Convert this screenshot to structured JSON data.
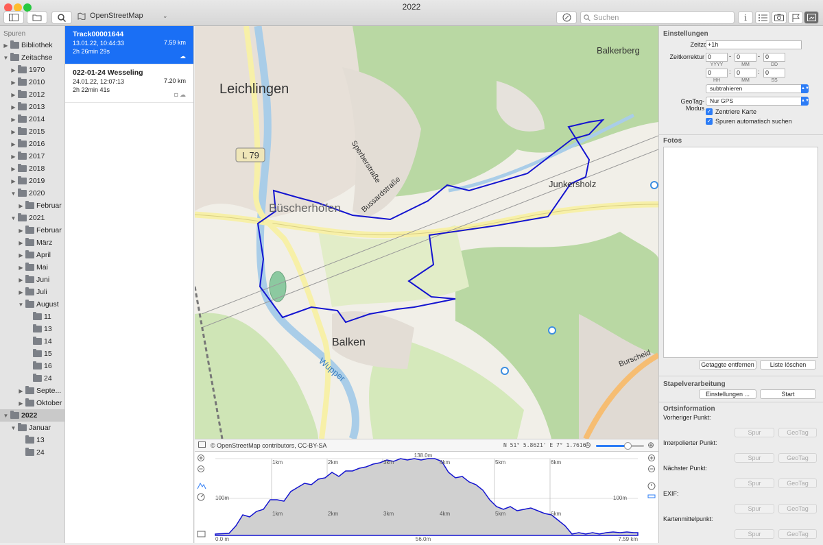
{
  "window": {
    "title": "2022"
  },
  "toolbar": {
    "map_source": "OpenStreetMap",
    "search_placeholder": "Suchen"
  },
  "sidebar": {
    "header": "Spuren",
    "items": [
      {
        "label": "Bibliothek",
        "level": 0,
        "expanded": false
      },
      {
        "label": "Zeitachse",
        "level": 0,
        "expanded": true
      },
      {
        "label": "1970",
        "level": 1,
        "expanded": false
      },
      {
        "label": "2010",
        "level": 1,
        "expanded": false
      },
      {
        "label": "2012",
        "level": 1,
        "expanded": false
      },
      {
        "label": "2013",
        "level": 1,
        "expanded": false
      },
      {
        "label": "2014",
        "level": 1,
        "expanded": false
      },
      {
        "label": "2015",
        "level": 1,
        "expanded": false
      },
      {
        "label": "2016",
        "level": 1,
        "expanded": false
      },
      {
        "label": "2017",
        "level": 1,
        "expanded": false
      },
      {
        "label": "2018",
        "level": 1,
        "expanded": false
      },
      {
        "label": "2019",
        "level": 1,
        "expanded": false
      },
      {
        "label": "2020",
        "level": 1,
        "expanded": true
      },
      {
        "label": "Februar",
        "level": 2,
        "expanded": false
      },
      {
        "label": "2021",
        "level": 1,
        "expanded": true
      },
      {
        "label": "Februar",
        "level": 2,
        "expanded": false
      },
      {
        "label": "März",
        "level": 2,
        "expanded": false
      },
      {
        "label": "April",
        "level": 2,
        "expanded": false
      },
      {
        "label": "Mai",
        "level": 2,
        "expanded": false
      },
      {
        "label": "Juni",
        "level": 2,
        "expanded": false
      },
      {
        "label": "Juli",
        "level": 2,
        "expanded": false
      },
      {
        "label": "August",
        "level": 2,
        "expanded": true
      },
      {
        "label": "11",
        "level": 3,
        "leaf": true
      },
      {
        "label": "13",
        "level": 3,
        "leaf": true
      },
      {
        "label": "14",
        "level": 3,
        "leaf": true
      },
      {
        "label": "15",
        "level": 3,
        "leaf": true
      },
      {
        "label": "16",
        "level": 3,
        "leaf": true
      },
      {
        "label": "24",
        "level": 3,
        "leaf": true
      },
      {
        "label": "Septe...",
        "level": 2,
        "expanded": false
      },
      {
        "label": "Oktober",
        "level": 2,
        "expanded": false
      },
      {
        "label": "2022",
        "level": 0,
        "expanded": true,
        "selected": true
      },
      {
        "label": "Januar",
        "level": 1,
        "expanded": true
      },
      {
        "label": "13",
        "level": 2,
        "leaf": true
      },
      {
        "label": "24",
        "level": 2,
        "leaf": true
      }
    ]
  },
  "tracks": [
    {
      "name": "Track00001644",
      "date": "13.01.22, 10:44:33",
      "duration": "2h 26min 29s",
      "distance": "7.59 km",
      "selected": true
    },
    {
      "name": "022-01-24 Wesseling",
      "date": "24.01.22, 12:07:13",
      "duration": "2h 22min 41s",
      "distance": "7.20 km",
      "selected": false
    }
  ],
  "map": {
    "labels": {
      "leichlingen": "Leichlingen",
      "balkerberg": "Balkerberg",
      "l79": "L 79",
      "sperber": "Sperberstraße",
      "bussard": "Bussardstraße",
      "buescherhoefen": "Büscherhöfen",
      "junkersholz": "Junkersholz",
      "balken": "Balken",
      "wupper": "Wupper",
      "burscheid": "Burscheid"
    },
    "attribution": "© OpenStreetMap contributors, CC-BY-SA",
    "coords": "N 51° 5.8621' E 7° 1.7616'",
    "zoom_fraction": 0.66
  },
  "elevation": {
    "max_label": "138.0m",
    "mid_label": "100m",
    "min_label": "56.0m",
    "start_label": "0.0 m",
    "end_label": "7.59 km",
    "km_labels": [
      "1km",
      "2km",
      "3km",
      "4km",
      "5km",
      "6km"
    ]
  },
  "settings": {
    "section": "Einstellungen",
    "zeitzone_label": "Zeitzone",
    "zeitzone_value": "+1h",
    "zeitkorrektur_label": "Zeitkorrektur",
    "date_values": [
      "0",
      "0",
      "0"
    ],
    "date_units": [
      "YYYY",
      "MM",
      "DD"
    ],
    "time_values": [
      "0",
      "0",
      "0"
    ],
    "time_units": [
      "HH",
      "MM",
      "SS"
    ],
    "operation": "subtrahieren",
    "geotag_label": "GeoTag-Modus",
    "geotag_value": "Nur GPS",
    "center_map": "Zentriere Karte",
    "auto_search": "Spuren automatisch suchen"
  },
  "photos": {
    "section": "Fotos",
    "remove_button": "Getaggte entfernen",
    "clear_button": "Liste löschen"
  },
  "batch": {
    "section": "Stapelverarbeitung",
    "settings_button": "Einstellungen ...",
    "start_button": "Start"
  },
  "location": {
    "section": "Ortsinformation",
    "rows": [
      "Vorheriger Punkt:",
      "Interpolierter Punkt:",
      "Nächster Punkt:",
      "EXIF:",
      "Kartenmittelpunkt:"
    ],
    "track_button": "Spur",
    "geotag_button": "GeoTag"
  },
  "colors": {
    "accent": "#1a6ff5",
    "track": "#1414d0"
  }
}
